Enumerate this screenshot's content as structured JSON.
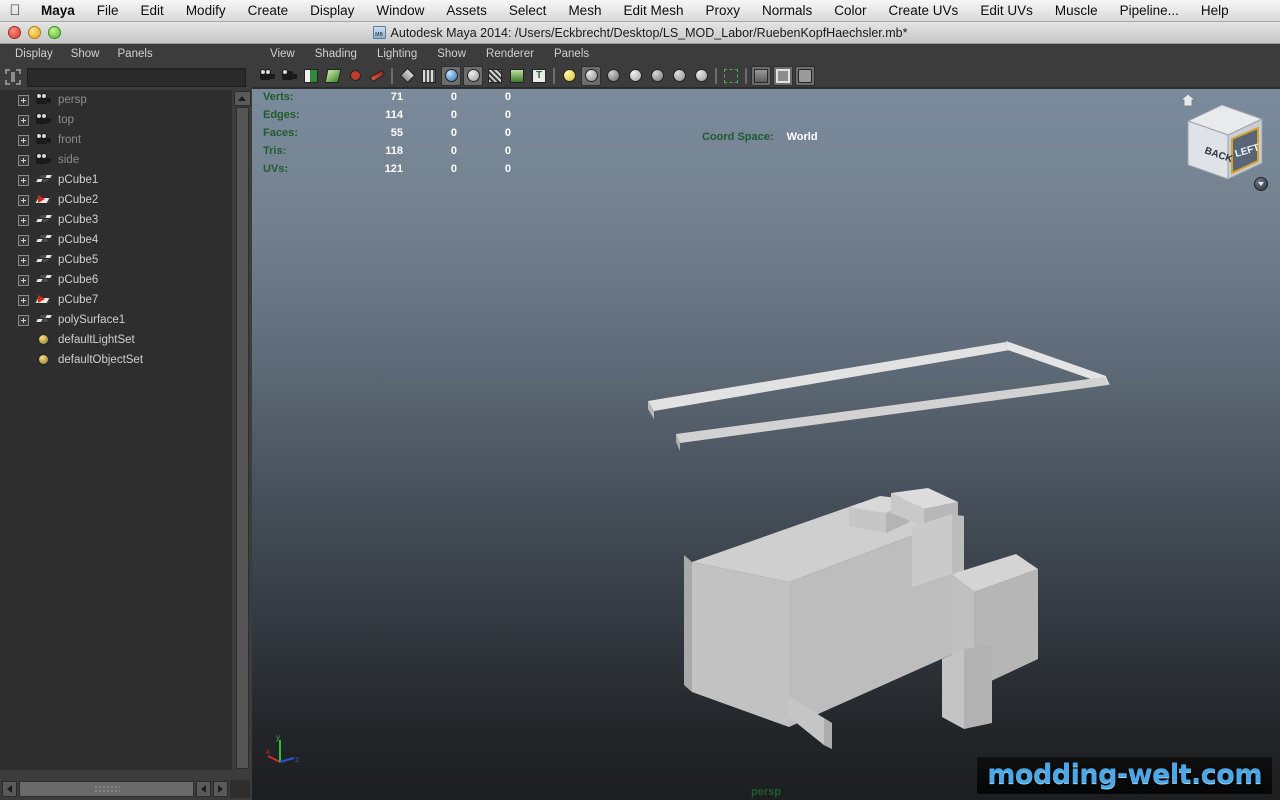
{
  "os_menu": {
    "apple_icon": "apple-logo-icon",
    "items": [
      {
        "label": "Maya",
        "bold": true
      },
      {
        "label": "File",
        "bold": false
      },
      {
        "label": "Edit",
        "bold": false
      },
      {
        "label": "Modify",
        "bold": false
      },
      {
        "label": "Create",
        "bold": false
      },
      {
        "label": "Display",
        "bold": false
      },
      {
        "label": "Window",
        "bold": false
      },
      {
        "label": "Assets",
        "bold": false
      },
      {
        "label": "Select",
        "bold": false
      },
      {
        "label": "Mesh",
        "bold": false
      },
      {
        "label": "Edit Mesh",
        "bold": false
      },
      {
        "label": "Proxy",
        "bold": false
      },
      {
        "label": "Normals",
        "bold": false
      },
      {
        "label": "Color",
        "bold": false
      },
      {
        "label": "Create UVs",
        "bold": false
      },
      {
        "label": "Edit UVs",
        "bold": false
      },
      {
        "label": "Muscle",
        "bold": false
      },
      {
        "label": "Pipeline...",
        "bold": false
      },
      {
        "label": "Help",
        "bold": false
      }
    ]
  },
  "titlebar": {
    "title": "Autodesk Maya 2014: /Users/Eckbrecht/Desktop/LS_MOD_Labor/RuebenKopfHaechsler.mb*",
    "file_icon_label": "MB",
    "close_label": "close",
    "minimize_label": "minimize",
    "zoom_label": "zoom"
  },
  "outliner": {
    "menu": [
      "Display",
      "Show",
      "Panels"
    ],
    "search": {
      "value": "",
      "placeholder": ""
    },
    "items": [
      {
        "label": "persp",
        "icon": "camera-icon",
        "expandable": true,
        "dim": true
      },
      {
        "label": "top",
        "icon": "camera-icon",
        "expandable": true,
        "dim": true
      },
      {
        "label": "front",
        "icon": "camera-icon",
        "expandable": true,
        "dim": true
      },
      {
        "label": "side",
        "icon": "camera-icon",
        "expandable": true,
        "dim": true
      },
      {
        "label": "pCube1",
        "icon": "mesh-icon",
        "expandable": true,
        "dim": false
      },
      {
        "label": "pCube2",
        "icon": "transform-icon",
        "expandable": true,
        "dim": false
      },
      {
        "label": "pCube3",
        "icon": "mesh-icon",
        "expandable": true,
        "dim": false
      },
      {
        "label": "pCube4",
        "icon": "mesh-icon",
        "expandable": true,
        "dim": false
      },
      {
        "label": "pCube5",
        "icon": "mesh-icon",
        "expandable": true,
        "dim": false
      },
      {
        "label": "pCube6",
        "icon": "mesh-icon",
        "expandable": true,
        "dim": false
      },
      {
        "label": "pCube7",
        "icon": "transform-icon",
        "expandable": true,
        "dim": false
      },
      {
        "label": "polySurface1",
        "icon": "mesh-icon",
        "expandable": true,
        "dim": false
      },
      {
        "label": "defaultLightSet",
        "icon": "set-icon",
        "expandable": false,
        "dim": false
      },
      {
        "label": "defaultObjectSet",
        "icon": "set-icon",
        "expandable": false,
        "dim": false
      }
    ]
  },
  "viewport": {
    "menu": [
      "View",
      "Shading",
      "Lighting",
      "Show",
      "Renderer",
      "Panels"
    ],
    "toolbar_icons": [
      "select-camera-icon",
      "camera-attributes-icon",
      "bookmark-icon",
      "image-plane-icon",
      "resolution-gate-icon",
      "paint-icon",
      "wireframe-icon",
      "filmgate-icon",
      "smooth-shade-icon",
      "flat-shade-icon",
      "wireframe-on-shaded-icon",
      "texture-icon",
      "text-icon",
      "xray-icon",
      "light-icon",
      "shadow-icon",
      "ao-icon",
      "motionblur-icon",
      "hardware-fog-icon",
      "select-region-icon",
      "isolate-select-icon",
      "grid-icon",
      "frame-all-icon",
      "share-icon"
    ],
    "camera_label": "persp",
    "hud": {
      "stats": [
        {
          "label": "Verts:",
          "total": "71",
          "selected": "0",
          "sub": "0"
        },
        {
          "label": "Edges:",
          "total": "114",
          "selected": "0",
          "sub": "0"
        },
        {
          "label": "Faces:",
          "total": "55",
          "selected": "0",
          "sub": "0"
        },
        {
          "label": "Tris:",
          "total": "118",
          "selected": "0",
          "sub": "0"
        },
        {
          "label": "UVs:",
          "total": "121",
          "selected": "0",
          "sub": "0"
        }
      ],
      "coord_space_label": "Coord Space:",
      "coord_space_value": "World"
    },
    "viewcube": {
      "face_left": "BACK",
      "face_right": "LEFT",
      "home_icon": "home-icon",
      "menu_icon": "chevron-down-icon"
    },
    "axis": {
      "x": "x",
      "y": "y",
      "z": "z",
      "x_color": "#d12b2b",
      "y_color": "#2fc02f",
      "z_color": "#2b53d1"
    }
  },
  "watermark": {
    "text": "modding-welt.com"
  },
  "colors": {
    "panel_bg": "#3c3c3c",
    "tree_bg": "#2e2e2e",
    "hud_green": "#1f5c2e",
    "hud_white": "#ffffff",
    "viewport_top": "#7b8a9c",
    "viewport_bottom": "#1c1e20",
    "model_fill": "#c9c9c9"
  }
}
